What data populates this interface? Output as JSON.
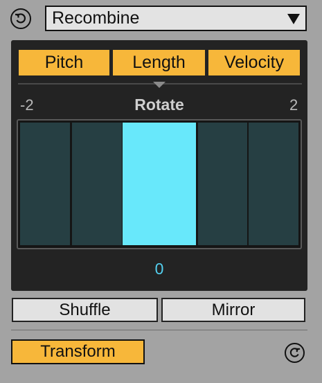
{
  "header": {
    "undo_icon": "undo-circle-icon",
    "dropdown": {
      "selected": "Recombine"
    }
  },
  "modes": [
    {
      "label": "Pitch",
      "active": true
    },
    {
      "label": "Length",
      "active": true
    },
    {
      "label": "Velocity",
      "active": true
    }
  ],
  "rotate": {
    "title": "Rotate",
    "min_label": "-2",
    "max_label": "2",
    "steps": [
      -2,
      -1,
      0,
      1,
      2
    ],
    "value": 0,
    "value_label": "0"
  },
  "actions": {
    "shuffle_label": "Shuffle",
    "mirror_label": "Mirror",
    "transform_label": "Transform",
    "redo_icon": "redo-circle-icon"
  },
  "colors": {
    "accent": "#f7b73a",
    "panel": "#232323",
    "cell_inactive": "#263f43",
    "cell_active": "#68e8fb",
    "value_text": "#53cfee"
  }
}
